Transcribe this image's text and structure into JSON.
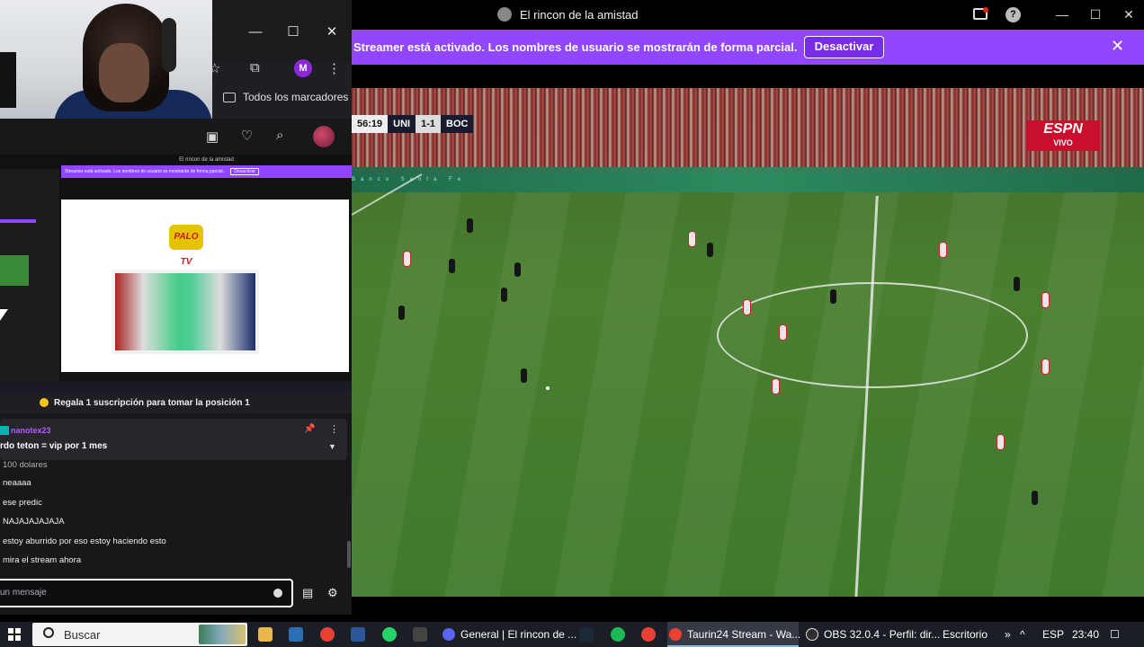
{
  "browser": {
    "minimize": "—",
    "maximize": "☐",
    "close": "✕",
    "bookmarks_label": "Todos los marcadores",
    "profile_initial": "M"
  },
  "nested": {
    "title": "El rincon de la amistad",
    "banner": "Streamer está activado. Los nombres de usuario se mostrarán de forma parcial.",
    "banner_btn": "Desactivar",
    "logo": "PALO TV"
  },
  "chat": {
    "sub_promo": "Regala 1 suscripción para tomar la posición 1",
    "pinned_user": "nanotex23",
    "pinned_msg": "rdo teton = vip por 1 mes",
    "messages": [
      "100 dolares",
      "neaaaa",
      "ese predic",
      "NAJAJAJAJAJA",
      "estoy aburrido por eso estoy haciendo esto",
      "mira el stream ahora"
    ],
    "input_placeholder": "un mensaje"
  },
  "stream": {
    "title": "El rincon de la amistad",
    "banner_text": "Streamer está activado. Los nombres de usuario se mostrarán de forma parcial.",
    "banner_btn": "Desactivar",
    "scorebug": {
      "time": "56:19",
      "home": "UNI",
      "score": "1-1",
      "away": "BOC"
    },
    "broadcaster": "ESPN",
    "broadcaster_sub": "VIVO",
    "adboard": "Banco Santa Fe"
  },
  "taskbar": {
    "search": "Buscar",
    "apps": [
      {
        "label": "General | El rincon de ...",
        "color": "#5865f2"
      },
      {
        "label": "Taurin24 Stream - Wa...",
        "color": "#e94235"
      },
      {
        "label": "OBS 32.0.4 - Perfil: dir...",
        "color": "#302e31"
      }
    ],
    "desktop": "Escritorio",
    "lang": "ESP",
    "time": "23:40"
  }
}
